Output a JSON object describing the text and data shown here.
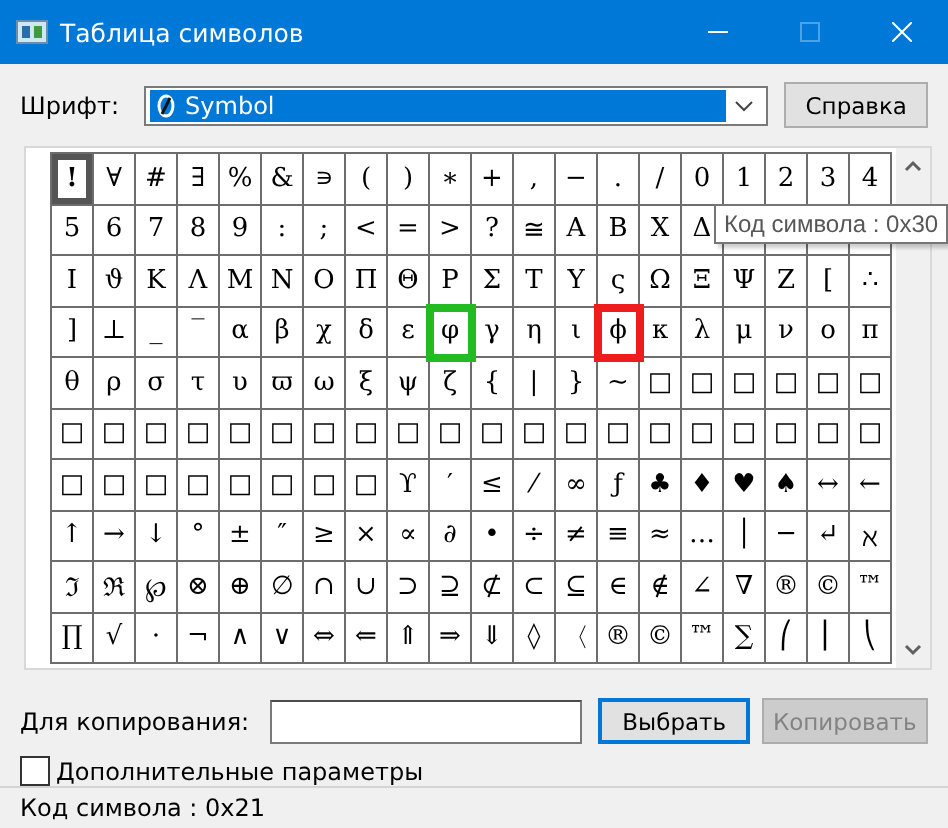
{
  "window": {
    "title": "Таблица символов",
    "maximize_disabled": true
  },
  "font": {
    "label": "Шрифт:",
    "value": "Symbol",
    "help_button": "Справка"
  },
  "grid": {
    "rows": [
      [
        {
          "char": "!",
          "selected": true
        },
        {
          "char": "∀",
          "selected": false
        },
        {
          "char": "#",
          "selected": false
        },
        {
          "char": "∃",
          "selected": false
        },
        {
          "char": "%",
          "selected": false
        },
        {
          "char": "&",
          "selected": false
        },
        {
          "char": "∍",
          "selected": false
        },
        {
          "char": "(",
          "selected": false
        },
        {
          "char": ")",
          "selected": false
        },
        {
          "char": "∗",
          "selected": false
        },
        {
          "char": "+",
          "selected": false
        },
        {
          "char": ",",
          "selected": false
        },
        {
          "char": "−",
          "selected": false
        },
        {
          "char": ".",
          "selected": false
        },
        {
          "char": "/",
          "selected": false
        },
        {
          "char": "0",
          "selected": false
        },
        {
          "char": "1",
          "selected": false
        },
        {
          "char": "2",
          "selected": false
        },
        {
          "char": "3",
          "selected": false
        },
        {
          "char": "4",
          "selected": false
        }
      ],
      [
        {
          "char": "5",
          "selected": false
        },
        {
          "char": "6",
          "selected": false
        },
        {
          "char": "7",
          "selected": false
        },
        {
          "char": "8",
          "selected": false
        },
        {
          "char": "9",
          "selected": false
        },
        {
          "char": ":",
          "selected": false
        },
        {
          "char": ";",
          "selected": false
        },
        {
          "char": "<",
          "selected": false
        },
        {
          "char": "=",
          "selected": false
        },
        {
          "char": ">",
          "selected": false
        },
        {
          "char": "?",
          "selected": false
        },
        {
          "char": "≅",
          "selected": false
        },
        {
          "char": "Α",
          "selected": false
        },
        {
          "char": "Β",
          "selected": false
        },
        {
          "char": "Χ",
          "selected": false
        },
        {
          "char": "Δ",
          "selected": false
        }
      ],
      [
        {
          "char": "Ι",
          "selected": false
        },
        {
          "char": "ϑ",
          "selected": false
        },
        {
          "char": "Κ",
          "selected": false
        },
        {
          "char": "Λ",
          "selected": false
        },
        {
          "char": "Μ",
          "selected": false
        },
        {
          "char": "Ν",
          "selected": false
        },
        {
          "char": "Ο",
          "selected": false
        },
        {
          "char": "Π",
          "selected": false
        },
        {
          "char": "Θ",
          "selected": false
        },
        {
          "char": "Ρ",
          "selected": false
        },
        {
          "char": "Σ",
          "selected": false
        },
        {
          "char": "Τ",
          "selected": false
        },
        {
          "char": "Υ",
          "selected": false
        },
        {
          "char": "ς",
          "selected": false
        },
        {
          "char": "Ω",
          "selected": false
        },
        {
          "char": "Ξ",
          "selected": false
        },
        {
          "char": "Ψ",
          "selected": false
        },
        {
          "char": "Ζ",
          "selected": false
        },
        {
          "char": "[",
          "selected": false
        },
        {
          "char": "∴",
          "selected": false
        }
      ],
      [
        {
          "char": "]",
          "selected": false
        },
        {
          "char": "⊥",
          "selected": false
        },
        {
          "char": "_",
          "selected": false
        },
        {
          "char": "‾",
          "selected": false
        },
        {
          "char": "α",
          "selected": false
        },
        {
          "char": "β",
          "selected": false
        },
        {
          "char": "χ",
          "selected": false
        },
        {
          "char": "δ",
          "selected": false
        },
        {
          "char": "ε",
          "selected": false
        },
        {
          "char": "φ",
          "selected": false,
          "color": "#22bb22"
        },
        {
          "char": "γ",
          "selected": false
        },
        {
          "char": "η",
          "selected": false
        },
        {
          "char": "ι",
          "selected": false
        },
        {
          "char": "ϕ",
          "selected": false,
          "color": "#ee1c1c"
        },
        {
          "char": "κ",
          "selected": false
        },
        {
          "char": "λ",
          "selected": false
        },
        {
          "char": "μ",
          "selected": false
        },
        {
          "char": "ν",
          "selected": false
        },
        {
          "char": "ο",
          "selected": false
        },
        {
          "char": "π",
          "selected": false
        }
      ],
      [
        {
          "char": "θ",
          "selected": false
        },
        {
          "char": "ρ",
          "selected": false
        },
        {
          "char": "σ",
          "selected": false
        },
        {
          "char": "τ",
          "selected": false
        },
        {
          "char": "υ",
          "selected": false
        },
        {
          "char": "ϖ",
          "selected": false
        },
        {
          "char": "ω",
          "selected": false
        },
        {
          "char": "ξ",
          "selected": false
        },
        {
          "char": "ψ",
          "selected": false
        },
        {
          "char": "ζ",
          "selected": false
        },
        {
          "char": "{",
          "selected": false
        },
        {
          "char": "|",
          "selected": false
        },
        {
          "char": "}",
          "selected": false
        },
        {
          "char": "~",
          "selected": false
        },
        {
          "char": "□",
          "selected": false
        },
        {
          "char": "□",
          "selected": false
        },
        {
          "char": "□",
          "selected": false
        },
        {
          "char": "□",
          "selected": false
        },
        {
          "char": "□",
          "selected": false
        },
        {
          "char": "□",
          "selected": false
        }
      ],
      [
        {
          "char": "□",
          "selected": false
        },
        {
          "char": "□",
          "selected": false
        },
        {
          "char": "□",
          "selected": false
        },
        {
          "char": "□",
          "selected": false
        },
        {
          "char": "□",
          "selected": false
        },
        {
          "char": "□",
          "selected": false
        },
        {
          "char": "□",
          "selected": false
        },
        {
          "char": "□",
          "selected": false
        },
        {
          "char": "□",
          "selected": false
        },
        {
          "char": "□",
          "selected": false
        },
        {
          "char": "□",
          "selected": false
        },
        {
          "char": "□",
          "selected": false
        },
        {
          "char": "□",
          "selected": false
        },
        {
          "char": "□",
          "selected": false
        },
        {
          "char": "□",
          "selected": false
        },
        {
          "char": "□",
          "selected": false
        },
        {
          "char": "□",
          "selected": false
        },
        {
          "char": "□",
          "selected": false
        },
        {
          "char": "□",
          "selected": false
        },
        {
          "char": "□",
          "selected": false
        }
      ],
      [
        {
          "char": "□",
          "selected": false
        },
        {
          "char": "□",
          "selected": false
        },
        {
          "char": "□",
          "selected": false
        },
        {
          "char": "□",
          "selected": false
        },
        {
          "char": "□",
          "selected": false
        },
        {
          "char": "□",
          "selected": false
        },
        {
          "char": "□",
          "selected": false
        },
        {
          "char": "□",
          "selected": false
        },
        {
          "char": "ϒ",
          "selected": false
        },
        {
          "char": "′",
          "selected": false
        },
        {
          "char": "≤",
          "selected": false
        },
        {
          "char": "⁄",
          "selected": false
        },
        {
          "char": "∞",
          "selected": false
        },
        {
          "char": "ƒ",
          "selected": false
        },
        {
          "char": "♣",
          "selected": false
        },
        {
          "char": "♦",
          "selected": false
        },
        {
          "char": "♥",
          "selected": false
        },
        {
          "char": "♠",
          "selected": false
        },
        {
          "char": "↔",
          "selected": false
        },
        {
          "char": "←",
          "selected": false
        }
      ],
      [
        {
          "char": "↑",
          "selected": false
        },
        {
          "char": "→",
          "selected": false
        },
        {
          "char": "↓",
          "selected": false
        },
        {
          "char": "°",
          "selected": false
        },
        {
          "char": "±",
          "selected": false
        },
        {
          "char": "″",
          "selected": false
        },
        {
          "char": "≥",
          "selected": false
        },
        {
          "char": "×",
          "selected": false
        },
        {
          "char": "∝",
          "selected": false
        },
        {
          "char": "∂",
          "selected": false
        },
        {
          "char": "•",
          "selected": false
        },
        {
          "char": "÷",
          "selected": false
        },
        {
          "char": "≠",
          "selected": false
        },
        {
          "char": "≡",
          "selected": false
        },
        {
          "char": "≈",
          "selected": false
        },
        {
          "char": "…",
          "selected": false
        },
        {
          "char": "│",
          "selected": false
        },
        {
          "char": "─",
          "selected": false
        },
        {
          "char": "↵",
          "selected": false
        },
        {
          "char": "ℵ",
          "selected": false
        }
      ],
      [
        {
          "char": "ℑ",
          "selected": false
        },
        {
          "char": "ℜ",
          "selected": false
        },
        {
          "char": "℘",
          "selected": false
        },
        {
          "char": "⊗",
          "selected": false
        },
        {
          "char": "⊕",
          "selected": false
        },
        {
          "char": "∅",
          "selected": false
        },
        {
          "char": "∩",
          "selected": false
        },
        {
          "char": "∪",
          "selected": false
        },
        {
          "char": "⊃",
          "selected": false
        },
        {
          "char": "⊇",
          "selected": false
        },
        {
          "char": "⊄",
          "selected": false
        },
        {
          "char": "⊂",
          "selected": false
        },
        {
          "char": "⊆",
          "selected": false
        },
        {
          "char": "∈",
          "selected": false
        },
        {
          "char": "∉",
          "selected": false
        },
        {
          "char": "∠",
          "selected": false
        },
        {
          "char": "∇",
          "selected": false
        },
        {
          "char": "®",
          "selected": false
        },
        {
          "char": "©",
          "selected": false
        },
        {
          "char": "™",
          "selected": false
        }
      ],
      [
        {
          "char": "∏",
          "selected": false
        },
        {
          "char": "√",
          "selected": false
        },
        {
          "char": "⋅",
          "selected": false
        },
        {
          "char": "¬",
          "selected": false
        },
        {
          "char": "∧",
          "selected": false
        },
        {
          "char": "∨",
          "selected": false
        },
        {
          "char": "⇔",
          "selected": false
        },
        {
          "char": "⇐",
          "selected": false
        },
        {
          "char": "⇑",
          "selected": false
        },
        {
          "char": "⇒",
          "selected": false
        },
        {
          "char": "⇓",
          "selected": false
        },
        {
          "char": "◊",
          "selected": false
        },
        {
          "char": "〈",
          "selected": false
        },
        {
          "char": "®",
          "selected": false
        },
        {
          "char": "©",
          "selected": false
        },
        {
          "char": "™",
          "selected": false
        },
        {
          "char": "∑",
          "selected": false
        },
        {
          "char": "⎛",
          "selected": false
        },
        {
          "char": "⎜",
          "selected": false
        },
        {
          "char": "⎝",
          "selected": false
        }
      ]
    ],
    "tooltip": "Код символа : 0x30"
  },
  "copy": {
    "label": "Для копирования:",
    "select_button": "Выбрать",
    "copy_button": "Копировать",
    "copy_disabled": true
  },
  "advanced": {
    "label": "Дополнительные параметры",
    "checked": false
  },
  "status_bar": "Код символа : 0x21"
}
